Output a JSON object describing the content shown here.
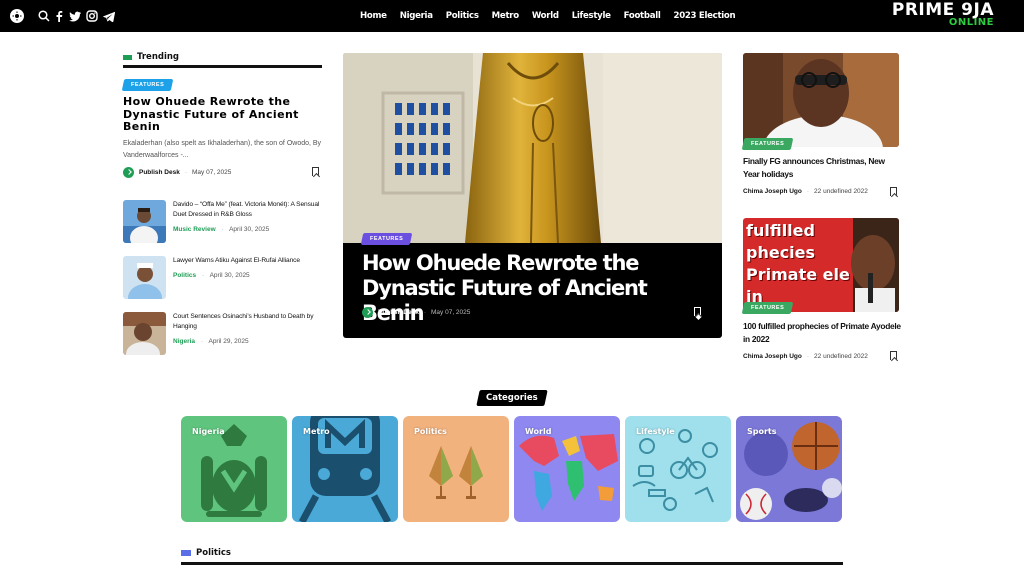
{
  "header": {
    "nav": [
      "Home",
      "Nigeria",
      "Politics",
      "Metro",
      "World",
      "Lifestyle",
      "Football",
      "2023 Election"
    ],
    "logo_line1": "PRIME 9JA",
    "logo_line2": "ONLINE",
    "icons": [
      "theme-toggle-icon",
      "search-icon",
      "facebook-icon",
      "twitter-icon",
      "instagram-icon",
      "telegram-icon"
    ]
  },
  "trending": {
    "heading": "Trending",
    "featured": {
      "badge": "FEATURES",
      "title": "How Ohuede Rewrote the Dynastic Future of Ancient Benin",
      "excerpt": "Ekaladerhan (also spelt as Ikhaladerhan), the son of Owodo, By Vanderwaalforces -...",
      "author": "Publish Desk",
      "date": "May 07, 2025"
    },
    "items": [
      {
        "title": "Davido – “Offa Me” (feat. Victoria Monét): A Sensual Duet Dressed in R&B Gloss",
        "category": "Music Review",
        "date": "April 30, 2025"
      },
      {
        "title": "Lawyer Warns Atiku Against El-Rufai Alliance",
        "category": "Politics",
        "date": "April 30, 2025"
      },
      {
        "title": "Court Sentences Osinachi’s Husband to Death by Hanging",
        "category": "Nigeria",
        "date": "April 29, 2025"
      }
    ]
  },
  "hero": {
    "badge": "FEATURES",
    "title": "How Ohuede Rewrote the Dynastic Future of Ancient Benin",
    "author": "Publish Desk",
    "date": "May 07, 2025"
  },
  "side": [
    {
      "badge": "FEATURES",
      "title": "Finally FG announces Christmas, New Year holidays",
      "author": "Chima Joseph Ugo",
      "date": "22 undefined 2022"
    },
    {
      "badge": "FEATURES",
      "title": "100 fulfilled prophecies of Primate Ayodele in 2022",
      "author": "Chima Joseph Ugo",
      "date": "22 undefined 2022",
      "image_text": "fulfilled phecies Primate ele in"
    }
  ],
  "categories": {
    "heading": "Categories",
    "tiles": [
      {
        "label": "Nigeria",
        "color": "#5fc57e"
      },
      {
        "label": "Metro",
        "color": "#4aa9d6"
      },
      {
        "label": "Politics",
        "color": "#f2b27e"
      },
      {
        "label": "World",
        "color": "#8e88f0"
      },
      {
        "label": "Lifestyle",
        "color": "#9fe0ec"
      },
      {
        "label": "Sports",
        "color": "#7b78d8"
      }
    ]
  },
  "politics": {
    "heading": "Politics"
  },
  "colors": {
    "accent_green": "#1f9d55",
    "badge_blue": "#1da1e8",
    "badge_purple": "#6b4fe0",
    "badge_green": "#3aa860",
    "politics_mark": "#5a6ee8"
  }
}
